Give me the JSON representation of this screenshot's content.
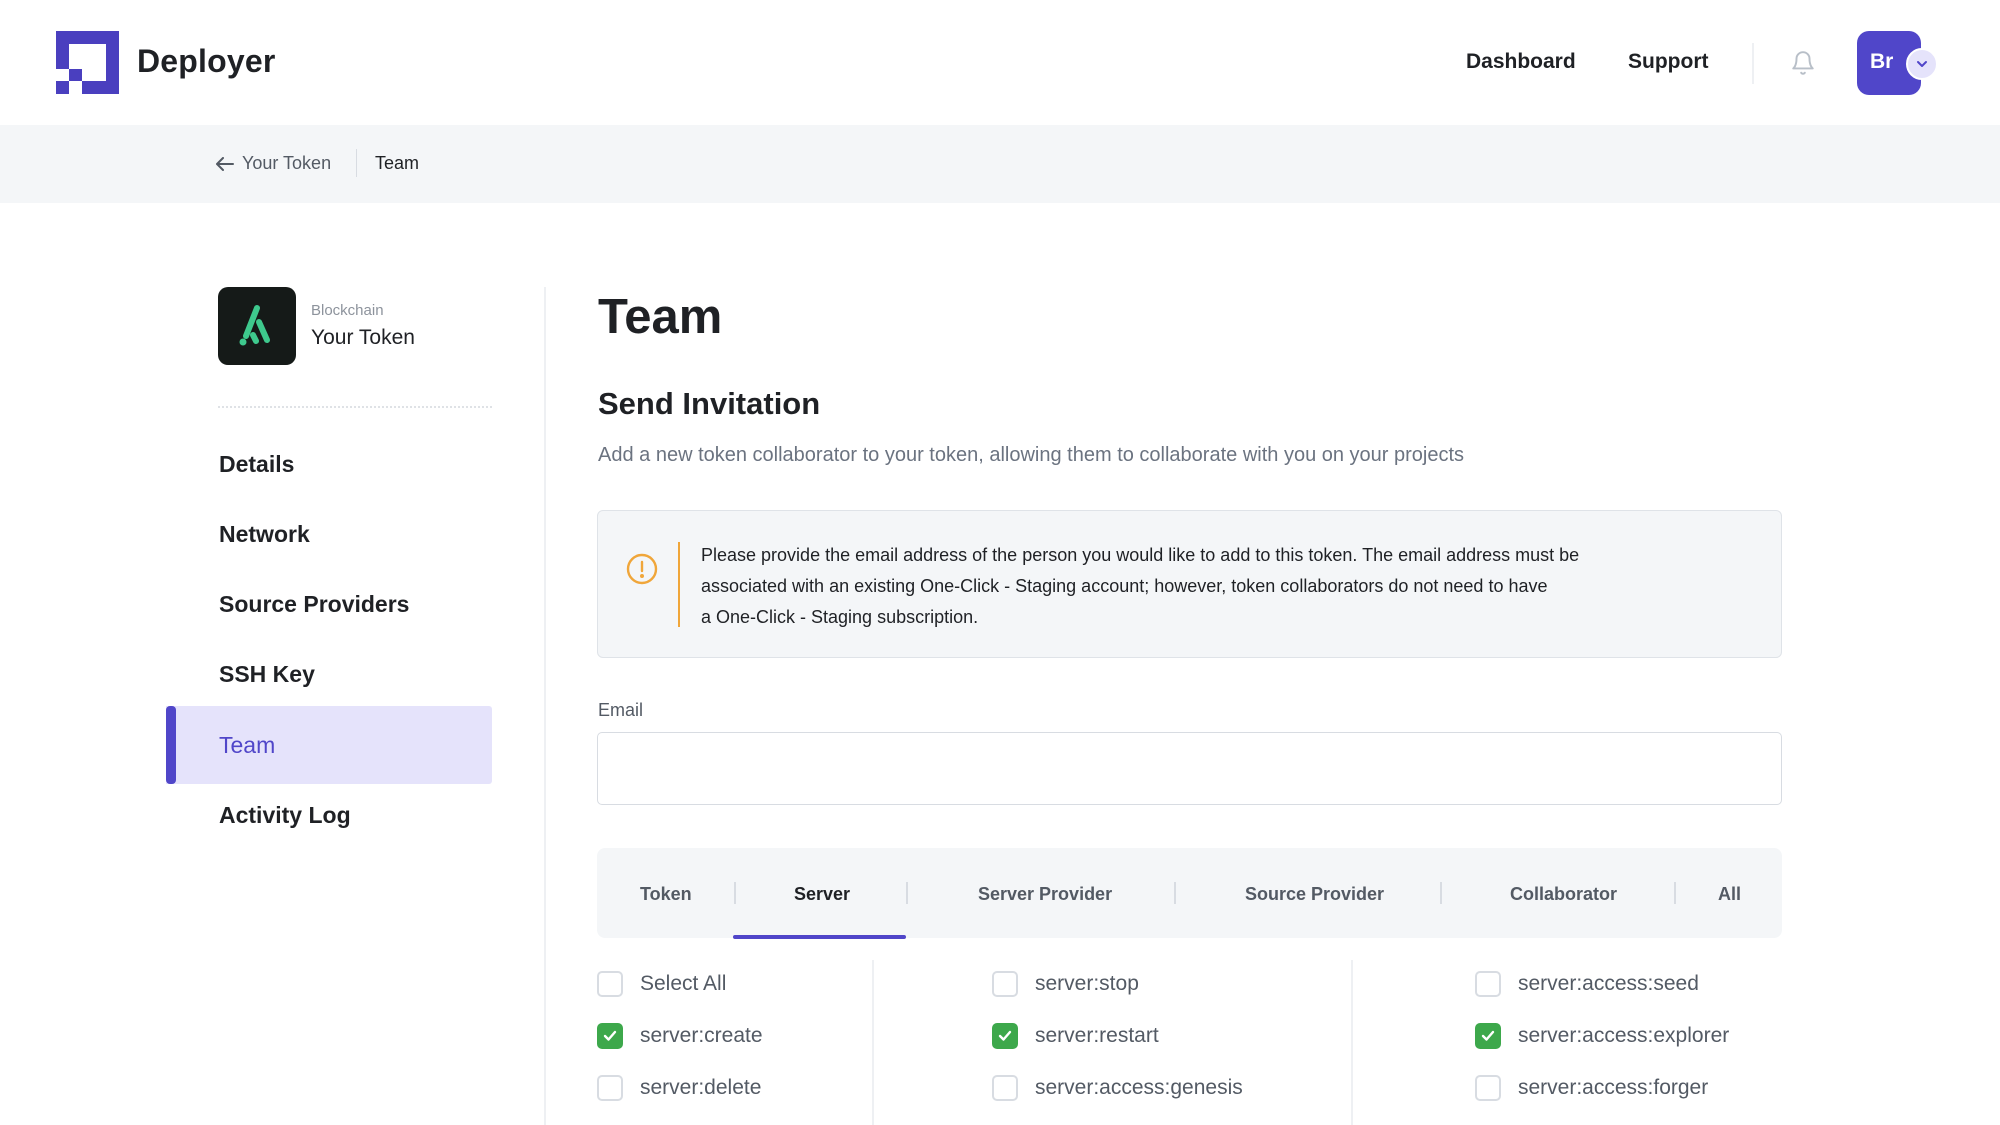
{
  "header": {
    "brand": "Deployer",
    "nav": {
      "dashboard": "Dashboard",
      "support": "Support"
    },
    "avatar_initials": "Br"
  },
  "breadcrumb": {
    "back": "Your Token",
    "current": "Team"
  },
  "project": {
    "category": "Blockchain",
    "name": "Your Token"
  },
  "sidebar": {
    "items": [
      {
        "label": "Details"
      },
      {
        "label": "Network"
      },
      {
        "label": "Source Providers"
      },
      {
        "label": "SSH Key"
      },
      {
        "label": "Team",
        "active": true
      },
      {
        "label": "Activity Log"
      }
    ]
  },
  "main": {
    "title": "Team",
    "section_title": "Send Invitation",
    "section_desc": "Add a new token collaborator to your token, allowing them to collaborate with you on your projects",
    "alert_text": "Please provide the email address of the person you would like to add to this token. The email address must be\nassociated with an existing One-Click - Staging account; however, token collaborators do not need to have\na One-Click - Staging subscription.",
    "email_label": "Email",
    "email_value": "",
    "tabs": [
      {
        "label": "Token"
      },
      {
        "label": "Server",
        "active": true
      },
      {
        "label": "Server Provider"
      },
      {
        "label": "Source Provider"
      },
      {
        "label": "Collaborator"
      },
      {
        "label": "All"
      }
    ],
    "permissions": [
      {
        "label": "Select All",
        "checked": false
      },
      {
        "label": "server:create",
        "checked": true
      },
      {
        "label": "server:delete",
        "checked": false
      },
      {
        "label": "server:stop",
        "checked": false
      },
      {
        "label": "server:restart",
        "checked": true
      },
      {
        "label": "server:access:genesis",
        "checked": false
      },
      {
        "label": "server:access:seed",
        "checked": false
      },
      {
        "label": "server:access:explorer",
        "checked": true
      },
      {
        "label": "server:access:forger",
        "checked": false
      }
    ]
  },
  "colors": {
    "accent": "#5046c9",
    "accent_light": "#e5e3fb",
    "success": "#3da84b",
    "warning": "#f0a63a"
  }
}
